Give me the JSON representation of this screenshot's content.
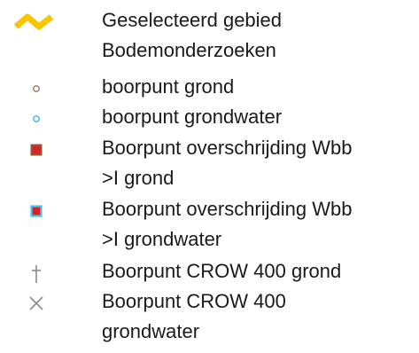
{
  "legend": {
    "items": [
      {
        "symbol": "yellow-zigzag-line",
        "label_lines": [
          "Geselecteerd gebied"
        ],
        "color": "#f7c600"
      },
      {
        "symbol": "none",
        "label_lines": [
          "Bodemonderzoeken"
        ]
      },
      {
        "symbol": "small-brown-circle",
        "label_lines": [
          "boorpunt grond"
        ],
        "color": "#a0765a"
      },
      {
        "symbol": "small-cyan-circle",
        "label_lines": [
          "boorpunt grondwater"
        ],
        "color": "#3fb8e0"
      },
      {
        "symbol": "brown-outlined-red-square",
        "label_lines": [
          "Boorpunt overschrijding Wbb",
          ">I grond"
        ],
        "fill_color": "#e02020",
        "stroke_color": "#8b5a3c"
      },
      {
        "symbol": "cyan-outlined-red-square",
        "label_lines": [
          "Boorpunt overschrijding Wbb",
          ">I grondwater"
        ],
        "fill_color": "#e02020",
        "stroke_color": "#40c8f0"
      },
      {
        "symbol": "dagger-cross",
        "label_lines": [
          "Boorpunt CROW 400 grond"
        ],
        "color": "#8a8a8a"
      },
      {
        "symbol": "x-cross",
        "label_lines": [
          "Boorpunt CROW 400",
          "grondwater"
        ],
        "color": "#8a8a8a"
      }
    ]
  }
}
